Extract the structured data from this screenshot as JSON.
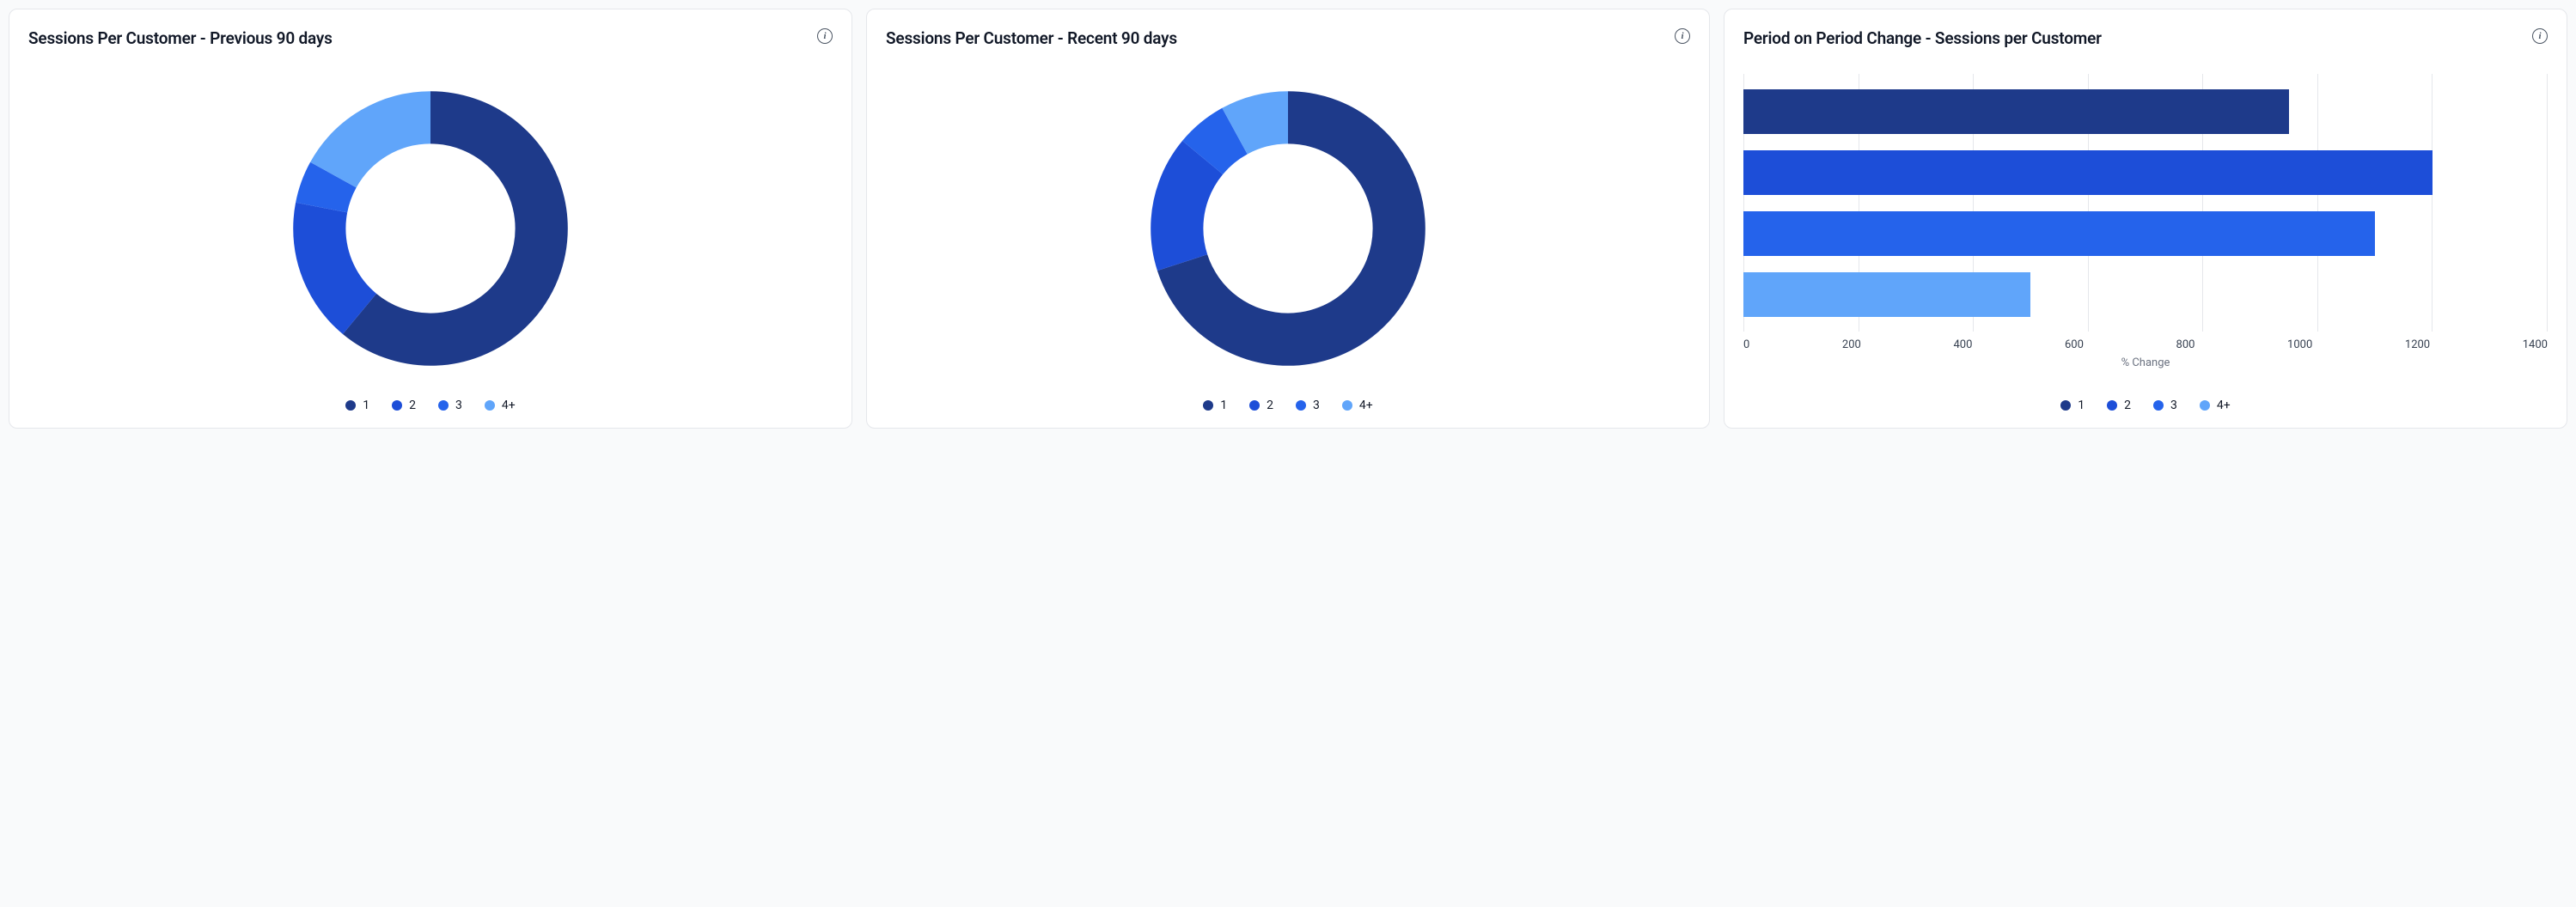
{
  "colors": {
    "c1": "#1e3a8a",
    "c2": "#1d4ed8",
    "c3": "#2563eb",
    "c4": "#60a5fa"
  },
  "cards": {
    "donut_prev": {
      "title": "Sessions Per Customer - Previous 90 days",
      "legend": [
        "1",
        "2",
        "3",
        "4+"
      ]
    },
    "donut_recent": {
      "title": "Sessions Per Customer - Recent 90 days",
      "legend": [
        "1",
        "2",
        "3",
        "4+"
      ]
    },
    "bar": {
      "title": "Period on Period Change - Sessions per Customer",
      "xlabel": "% Change",
      "legend": [
        "1",
        "2",
        "3",
        "4+"
      ]
    }
  },
  "chart_data": [
    {
      "type": "pie",
      "title": "Sessions Per Customer - Previous 90 days",
      "categories": [
        "1",
        "2",
        "3",
        "4+"
      ],
      "values": [
        61,
        17,
        5,
        17
      ],
      "donut": true
    },
    {
      "type": "pie",
      "title": "Sessions Per Customer - Recent 90 days",
      "categories": [
        "1",
        "2",
        "3",
        "4+"
      ],
      "values": [
        70,
        16,
        6,
        8
      ],
      "donut": true
    },
    {
      "type": "bar",
      "orientation": "horizontal",
      "title": "Period on Period Change - Sessions per Customer",
      "categories": [
        "1",
        "2",
        "3",
        "4+"
      ],
      "values": [
        950,
        1200,
        1100,
        500
      ],
      "xlabel": "% Change",
      "xticks": [
        0,
        200,
        400,
        600,
        800,
        1000,
        1200,
        1400
      ],
      "xlim": [
        0,
        1400
      ]
    }
  ]
}
